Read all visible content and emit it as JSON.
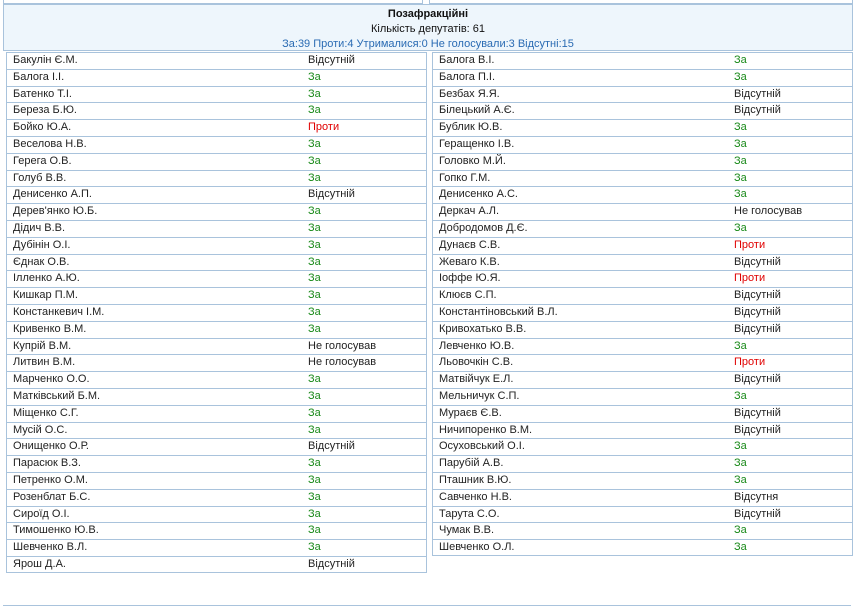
{
  "faction": {
    "title": "Позафракційні",
    "count": "Кількість депутатів: 61",
    "summary": "За:39 Проти:4 Утрималися:0 Не голосували:3 Відсутні:15"
  },
  "colors": {
    "for": "#1a8a1a",
    "against": "#e00000",
    "header_bg": "#eef6fc",
    "border": "#a9c3dc",
    "summary_text": "#2a6bb3"
  },
  "left": [
    {
      "name": "Бакулін Є.М.",
      "vote": "Відсутній",
      "type": "absent"
    },
    {
      "name": "Балога І.І.",
      "vote": "За",
      "type": "for"
    },
    {
      "name": "Батенко Т.І.",
      "vote": "За",
      "type": "for"
    },
    {
      "name": "Береза Б.Ю.",
      "vote": "За",
      "type": "for"
    },
    {
      "name": "Бойко Ю.А.",
      "vote": "Проти",
      "type": "against"
    },
    {
      "name": "Веселова Н.В.",
      "vote": "За",
      "type": "for"
    },
    {
      "name": "Герега О.В.",
      "vote": "За",
      "type": "for"
    },
    {
      "name": "Голуб В.В.",
      "vote": "За",
      "type": "for"
    },
    {
      "name": "Денисенко А.П.",
      "vote": "Відсутній",
      "type": "absent"
    },
    {
      "name": "Дерев'янко Ю.Б.",
      "vote": "За",
      "type": "for"
    },
    {
      "name": "Дідич В.В.",
      "vote": "За",
      "type": "for"
    },
    {
      "name": "Дубінін О.І.",
      "vote": "За",
      "type": "for"
    },
    {
      "name": "Єднак О.В.",
      "vote": "За",
      "type": "for"
    },
    {
      "name": "Ілленко А.Ю.",
      "vote": "За",
      "type": "for"
    },
    {
      "name": "Кишкар П.М.",
      "vote": "За",
      "type": "for"
    },
    {
      "name": "Констанкевич І.М.",
      "vote": "За",
      "type": "for"
    },
    {
      "name": "Кривенко В.М.",
      "vote": "За",
      "type": "for"
    },
    {
      "name": "Купрій В.М.",
      "vote": "Не голосував",
      "type": "novote"
    },
    {
      "name": "Литвин В.М.",
      "vote": "Не голосував",
      "type": "novote"
    },
    {
      "name": "Марченко О.О.",
      "vote": "За",
      "type": "for"
    },
    {
      "name": "Матківський Б.М.",
      "vote": "За",
      "type": "for"
    },
    {
      "name": "Міщенко С.Г.",
      "vote": "За",
      "type": "for"
    },
    {
      "name": "Мусій О.С.",
      "vote": "За",
      "type": "for"
    },
    {
      "name": "Онищенко О.Р.",
      "vote": "Відсутній",
      "type": "absent"
    },
    {
      "name": "Парасюк В.З.",
      "vote": "За",
      "type": "for"
    },
    {
      "name": "Петренко О.М.",
      "vote": "За",
      "type": "for"
    },
    {
      "name": "Розенблат Б.С.",
      "vote": "За",
      "type": "for"
    },
    {
      "name": "Сироїд О.І.",
      "vote": "За",
      "type": "for"
    },
    {
      "name": "Тимошенко Ю.В.",
      "vote": "За",
      "type": "for"
    },
    {
      "name": "Шевченко В.Л.",
      "vote": "За",
      "type": "for"
    },
    {
      "name": "Ярош Д.А.",
      "vote": "Відсутній",
      "type": "absent"
    }
  ],
  "right": [
    {
      "name": "Балога В.І.",
      "vote": "За",
      "type": "for"
    },
    {
      "name": "Балога П.І.",
      "vote": "За",
      "type": "for"
    },
    {
      "name": "Безбах Я.Я.",
      "vote": "Відсутній",
      "type": "absent"
    },
    {
      "name": "Білецький А.Є.",
      "vote": "Відсутній",
      "type": "absent"
    },
    {
      "name": "Бублик Ю.В.",
      "vote": "За",
      "type": "for"
    },
    {
      "name": "Геращенко І.В.",
      "vote": "За",
      "type": "for"
    },
    {
      "name": "Головко М.Й.",
      "vote": "За",
      "type": "for"
    },
    {
      "name": "Гопко Г.М.",
      "vote": "За",
      "type": "for"
    },
    {
      "name": "Денисенко А.С.",
      "vote": "За",
      "type": "for"
    },
    {
      "name": "Деркач А.Л.",
      "vote": "Не голосував",
      "type": "novote"
    },
    {
      "name": "Добродомов Д.Є.",
      "vote": "За",
      "type": "for"
    },
    {
      "name": "Дунаєв С.В.",
      "vote": "Проти",
      "type": "against"
    },
    {
      "name": "Жеваго К.В.",
      "vote": "Відсутній",
      "type": "absent"
    },
    {
      "name": "Іоффе Ю.Я.",
      "vote": "Проти",
      "type": "against"
    },
    {
      "name": "Клюєв С.П.",
      "vote": "Відсутній",
      "type": "absent"
    },
    {
      "name": "Константіновський В.Л.",
      "vote": "Відсутній",
      "type": "absent"
    },
    {
      "name": "Кривохатько В.В.",
      "vote": "Відсутній",
      "type": "absent"
    },
    {
      "name": "Левченко Ю.В.",
      "vote": "За",
      "type": "for"
    },
    {
      "name": "Льовочкін С.В.",
      "vote": "Проти",
      "type": "against"
    },
    {
      "name": "Матвійчук Е.Л.",
      "vote": "Відсутній",
      "type": "absent"
    },
    {
      "name": "Мельничук С.П.",
      "vote": "За",
      "type": "for"
    },
    {
      "name": "Мураєв Є.В.",
      "vote": "Відсутній",
      "type": "absent"
    },
    {
      "name": "Ничипоренко В.М.",
      "vote": "Відсутній",
      "type": "absent"
    },
    {
      "name": "Осуховський О.І.",
      "vote": "За",
      "type": "for"
    },
    {
      "name": "Парубій А.В.",
      "vote": "За",
      "type": "for"
    },
    {
      "name": "Пташник В.Ю.",
      "vote": "За",
      "type": "for"
    },
    {
      "name": "Савченко Н.В.",
      "vote": "Відсутня",
      "type": "absent"
    },
    {
      "name": "Тарута С.О.",
      "vote": "Відсутній",
      "type": "absent"
    },
    {
      "name": "Чумак В.В.",
      "vote": "За",
      "type": "for"
    },
    {
      "name": "Шевченко О.Л.",
      "vote": "За",
      "type": "for"
    }
  ]
}
